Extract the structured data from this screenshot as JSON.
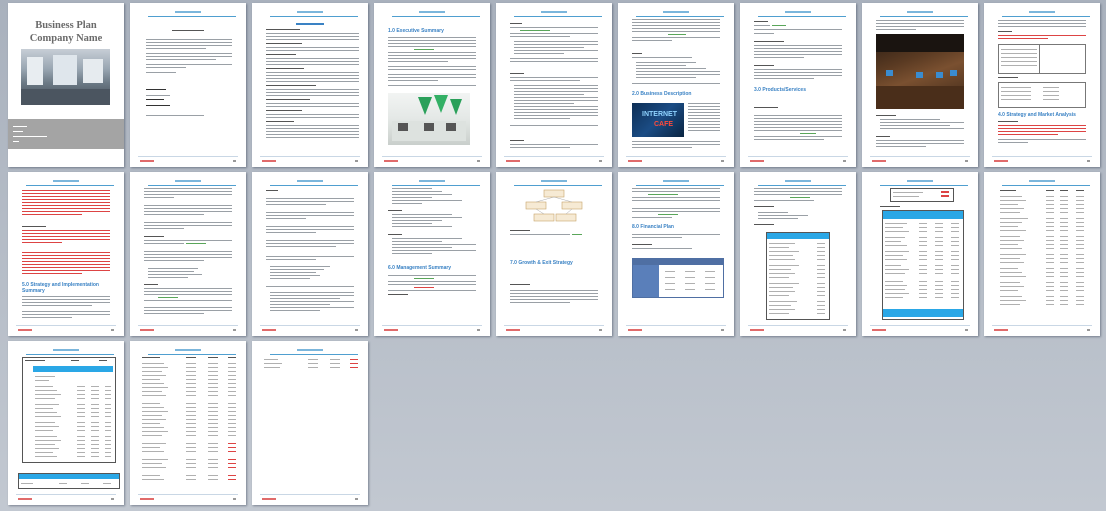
{
  "cover": {
    "title_line1": "Business Plan",
    "title_line2": "Company Name"
  },
  "pages": [
    {
      "id": 1,
      "kind": "cover"
    },
    {
      "id": 2,
      "kind": "text"
    },
    {
      "id": 3,
      "kind": "toc"
    },
    {
      "id": 4,
      "kind": "section",
      "heading": "1.0 Executive Summary"
    },
    {
      "id": 5,
      "kind": "text"
    },
    {
      "id": 6,
      "kind": "section",
      "heading": "2.0 Business Description"
    },
    {
      "id": 7,
      "kind": "section",
      "heading": "3.0 Products/Services"
    },
    {
      "id": 8,
      "kind": "photo"
    },
    {
      "id": 9,
      "kind": "section",
      "heading": "4.0 Strategy and Market Analysis"
    },
    {
      "id": 10,
      "kind": "section",
      "heading": "5.0 Strategy and Implementation Summary"
    },
    {
      "id": 11,
      "kind": "text"
    },
    {
      "id": 12,
      "kind": "text"
    },
    {
      "id": 13,
      "kind": "section",
      "heading": "6.0 Management Summary"
    },
    {
      "id": 14,
      "kind": "section",
      "heading": "7.0 Growth & Exit Strategy"
    },
    {
      "id": 15,
      "kind": "section",
      "heading": "8.0 Financial Plan"
    },
    {
      "id": 16,
      "kind": "table"
    },
    {
      "id": 17,
      "kind": "table"
    },
    {
      "id": 18,
      "kind": "table"
    },
    {
      "id": 19,
      "kind": "table"
    },
    {
      "id": 20,
      "kind": "table"
    },
    {
      "id": 21,
      "kind": "table"
    }
  ],
  "colors": {
    "accent": "#3a82c4",
    "header_bar": "#2aa7e6",
    "warning_text": "#d44444",
    "edit_mark": "#5aa65a"
  }
}
